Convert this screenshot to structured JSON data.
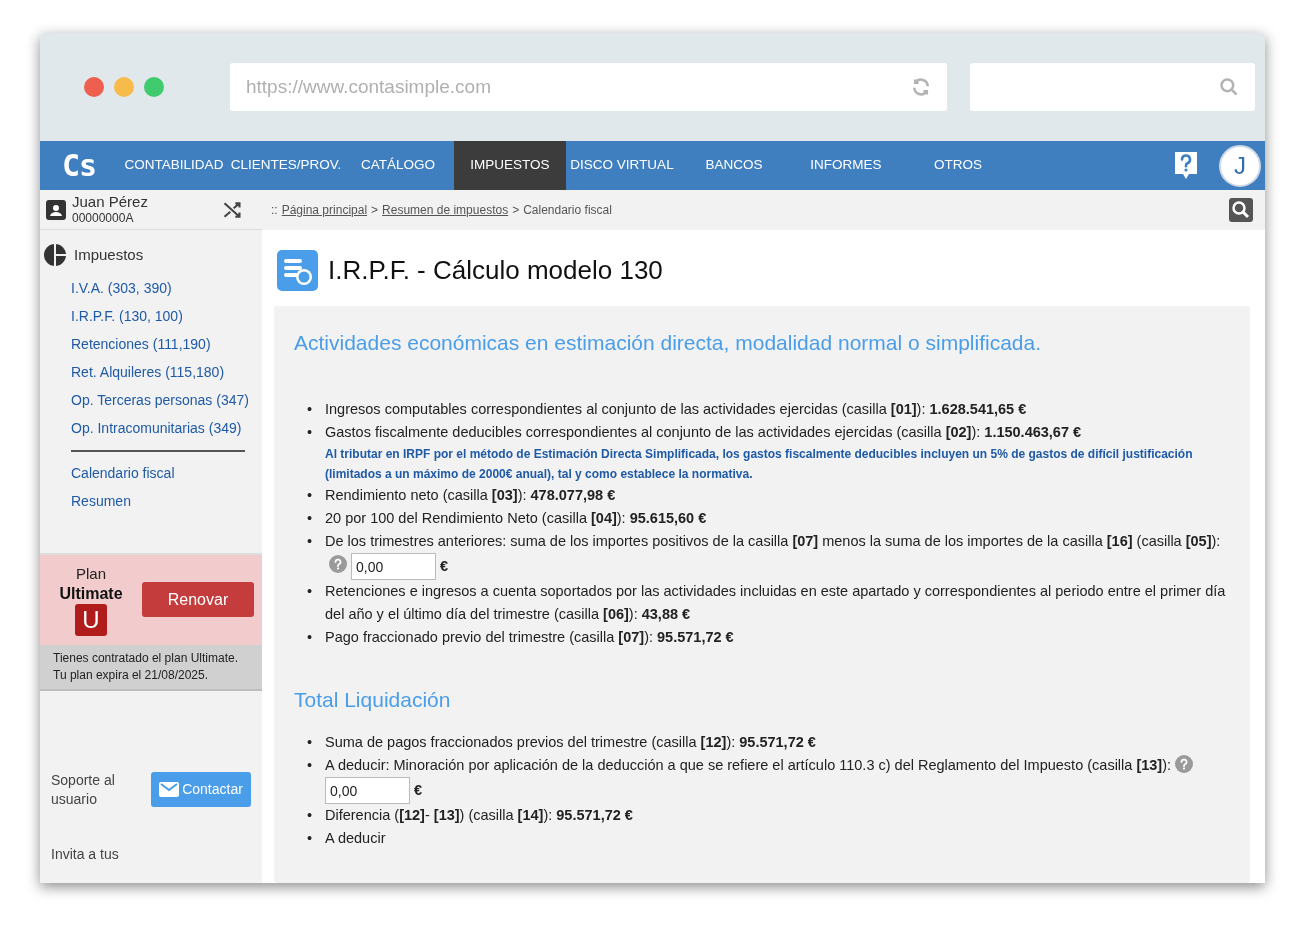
{
  "browser": {
    "url": "https://www.contasimple.com"
  },
  "nav": {
    "logo": "Cs",
    "items": [
      {
        "label": "CONTABILIDAD",
        "selected": false
      },
      {
        "label": "CLIENTES/PROV.",
        "selected": false
      },
      {
        "label": "CATÁLOGO",
        "selected": false
      },
      {
        "label": "IMPUESTOS",
        "selected": true
      },
      {
        "label": "DISCO VIRTUAL",
        "selected": false
      },
      {
        "label": "BANCOS",
        "selected": false
      },
      {
        "label": "INFORMES",
        "selected": false
      },
      {
        "label": "OTROS",
        "selected": false
      }
    ],
    "avatar": "J"
  },
  "user": {
    "name": "Juan Pérez",
    "id": "00000000A"
  },
  "breadcrumb": {
    "prefix": "::",
    "separator": ">",
    "links": [
      "Página principal",
      "Resumen de impuestos"
    ],
    "current": "Calendario fiscal"
  },
  "sidebar": {
    "section": "Impuestos",
    "items": [
      {
        "label": "I.V.A. (303, 390)",
        "divider_after": false
      },
      {
        "label": "I.R.P.F. (130, 100)",
        "divider_after": false
      },
      {
        "label": "Retenciones (111,190)",
        "divider_after": false
      },
      {
        "label": "Ret. Alquileres (115,180)",
        "divider_after": false
      },
      {
        "label": "Op. Terceras personas (347)",
        "divider_after": false
      },
      {
        "label": "Op. Intracomunitarias (349)",
        "divider_after": true
      },
      {
        "label": "Calendario fiscal",
        "divider_after": false
      },
      {
        "label": "Resumen",
        "divider_after": false
      }
    ]
  },
  "plan": {
    "label": "Plan",
    "name": "Ultimate",
    "badge": "U",
    "button": "Renovar",
    "notes": [
      "Tienes contratado el plan Ultimate.",
      "Tu plan expira el 21/08/2025."
    ]
  },
  "support": {
    "label": "Soporte al usuario",
    "button": "Contactar"
  },
  "invite": {
    "label": "Invita a tus"
  },
  "page": {
    "title": "I.R.P.F. - Cálculo modelo 130"
  },
  "list_marker": "•",
  "sections": [
    {
      "heading": "Actividades económicas en estimación directa, modalidad normal o simplificada.",
      "items": [
        {
          "kind": "text",
          "text": "Ingresos computables correspondientes al conjunto de las actividades ejercidas (casilla **[01]**): **1.628.541,65 €**"
        },
        {
          "kind": "text",
          "text": "Gastos fiscalmente deducibles correspondientes al conjunto de las actividades ejercidas (casilla **[02]**): **1.150.463,67 €**",
          "note": "Al tributar en IRPF por el método de Estimación Directa Simplificada, los gastos fiscalmente deducibles incluyen un 5% de gastos de difícil justificación (limitados a un máximo de 2000€ anual), tal y como establece la normativa."
        },
        {
          "kind": "text",
          "text": "Rendimiento neto (casilla **[03]**): **478.077,98 €**"
        },
        {
          "kind": "text",
          "text": "20 por 100 del Rendimiento Neto (casilla **[04]**): **95.615,60 €**"
        },
        {
          "kind": "input",
          "text": "De los trimestres anteriores: suma de los importes positivos de la casilla **[07]** menos la suma de los importes de la casilla **[16]** (casilla **[05]**):",
          "help": true,
          "value": "0,00",
          "unit": "€"
        },
        {
          "kind": "text",
          "text": "Retenciones e ingresos a cuenta soportados por las actividades incluidas en este apartado y correspondientes al periodo entre el primer día del año y el último día del trimestre (casilla **[06]**): **43,88 €**"
        },
        {
          "kind": "text",
          "text": "Pago fraccionado previo del trimestre (casilla **[07]**): **95.571,72 €**"
        }
      ]
    },
    {
      "heading": "Total Liquidación",
      "items": [
        {
          "kind": "text",
          "text": "Suma de pagos fraccionados previos del trimestre (casilla **[12]**): **95.571,72 €**"
        },
        {
          "kind": "input",
          "text": "A deducir: Minoración por aplicación de la deducción a que se refiere el artículo 110.3 c) del Reglamento del Impuesto (casilla **[13]**):",
          "help": true,
          "value": "0,00",
          "unit": "€"
        },
        {
          "kind": "text",
          "text": "Diferencia (**[12]**- **[13]**) (casilla **[14]**): **95.571,72 €**"
        },
        {
          "kind": "text",
          "text": "A deducir"
        }
      ]
    }
  ]
}
